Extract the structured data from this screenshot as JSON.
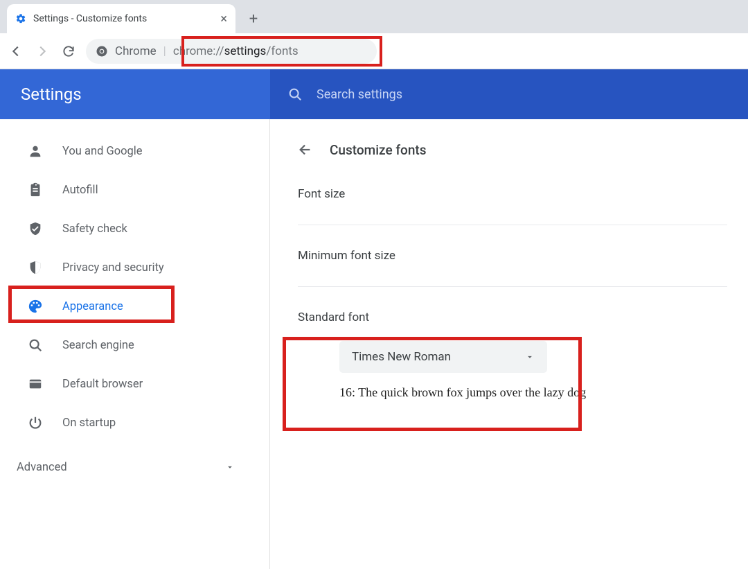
{
  "tab": {
    "title": "Settings - Customize fonts"
  },
  "omnibox": {
    "prefix": "Chrome",
    "scheme": "chrome://",
    "path_bold": "settings",
    "path_rest": "/fonts"
  },
  "header": {
    "title": "Settings",
    "search_placeholder": "Search settings"
  },
  "sidebar": {
    "items": [
      {
        "label": "You and Google"
      },
      {
        "label": "Autofill"
      },
      {
        "label": "Safety check"
      },
      {
        "label": "Privacy and security"
      },
      {
        "label": "Appearance"
      },
      {
        "label": "Search engine"
      },
      {
        "label": "Default browser"
      },
      {
        "label": "On startup"
      }
    ],
    "advanced_label": "Advanced"
  },
  "page": {
    "title": "Customize fonts",
    "font_size_label": "Font size",
    "min_font_size_label": "Minimum font size",
    "standard_font_label": "Standard font",
    "standard_font_value": "Times New Roman",
    "sample_text": "16: The quick brown fox jumps over the lazy dog"
  }
}
